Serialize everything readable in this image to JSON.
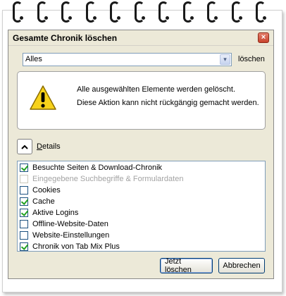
{
  "dialog": {
    "title": "Gesamte Chronik löschen",
    "close_label": "×"
  },
  "range": {
    "selected": "Alles",
    "suffix": "löschen",
    "arrow": "▾"
  },
  "warning": {
    "icon": "warning-icon",
    "line1": "Alle ausgewählten Elemente werden gelöscht.",
    "line2": "Diese Aktion kann nicht rückgängig gemacht werden."
  },
  "details": {
    "label_underlined": "D",
    "label_rest": "etails",
    "expanded": true
  },
  "items": [
    {
      "label": "Besuchte Seiten & Download-Chronik",
      "checked": true,
      "disabled": false
    },
    {
      "label": "Eingegebene Suchbegriffe & Formulardaten",
      "checked": false,
      "disabled": true
    },
    {
      "label": "Cookies",
      "checked": false,
      "disabled": false
    },
    {
      "label": "Cache",
      "checked": true,
      "disabled": false
    },
    {
      "label": "Aktive Logins",
      "checked": true,
      "disabled": false
    },
    {
      "label": "Offline-Website-Daten",
      "checked": false,
      "disabled": false
    },
    {
      "label": "Website-Einstellungen",
      "checked": false,
      "disabled": false
    },
    {
      "label": "Chronik von Tab Mix Plus",
      "checked": true,
      "disabled": false
    }
  ],
  "buttons": {
    "confirm": "Jetzt löschen",
    "cancel": "Abbrechen"
  },
  "colors": {
    "dialog_bg": "#ece9d8",
    "check": "#21a121",
    "close": "#c8432c",
    "warning": "#f7d21b"
  }
}
